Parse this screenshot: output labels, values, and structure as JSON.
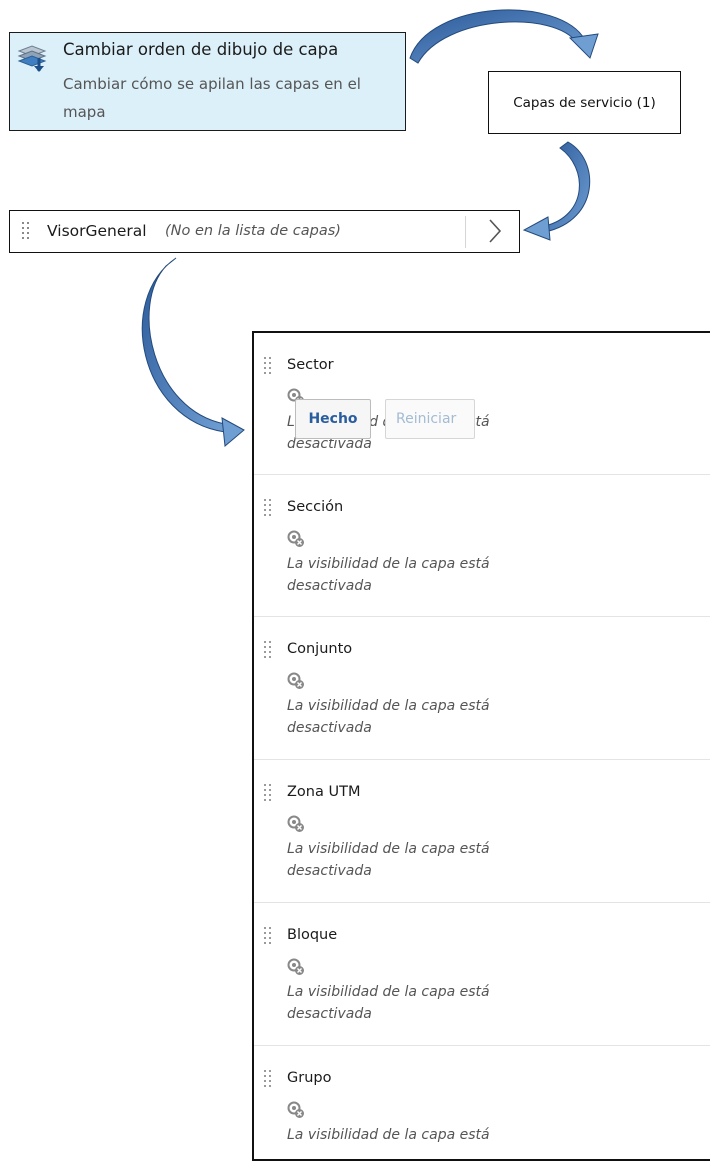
{
  "menu_item": {
    "title": "Cambiar orden de dibujo de capa",
    "description": "Cambiar cómo se apilan las capas en el mapa",
    "icon": "layer-order-icon"
  },
  "service_layers": {
    "label": "Capas de servicio (1)"
  },
  "visor": {
    "name": "VisorGeneral",
    "note": "(No en la lista de capas)",
    "icon": "chevron-right-icon"
  },
  "layers": [
    {
      "title": "Sector",
      "status": "La visibilidad de la capa está desactivada"
    },
    {
      "title": "Sección",
      "status": "La visibilidad de la capa está desactivada"
    },
    {
      "title": "Conjunto",
      "status": "La visibilidad de la capa está desactivada"
    },
    {
      "title": "Zona UTM",
      "status": "La visibilidad de la capa está desactivada"
    },
    {
      "title": "Bloque",
      "status": "La visibilidad de la capa está desactivada"
    },
    {
      "title": "Grupo",
      "status": "La visibilidad de la capa está"
    }
  ],
  "buttons": {
    "done": "Hecho",
    "reset": "Reiniciar"
  },
  "colors": {
    "menu_bg": "#dcf0fa",
    "arrow_fill": "#2f5e9e",
    "arrow_light": "#6f9ed3",
    "done_text": "#2a5d9f",
    "reset_text": "#a3bbd3"
  }
}
